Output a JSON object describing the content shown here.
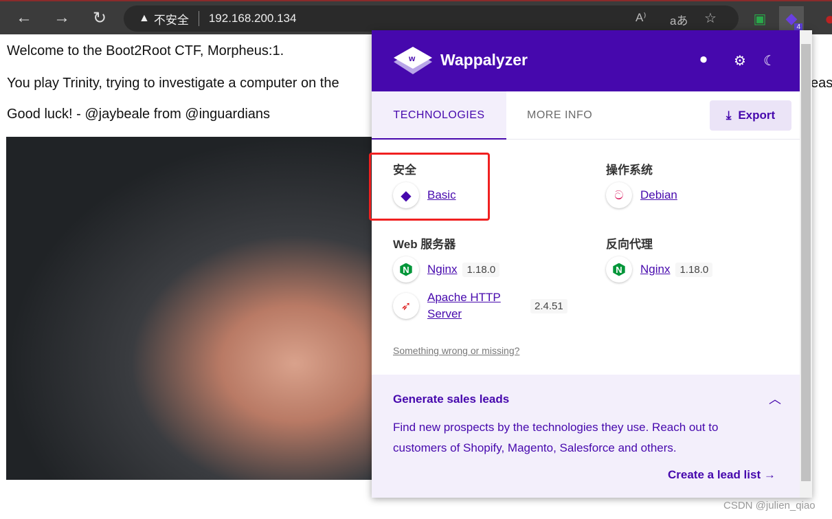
{
  "browser": {
    "security_label": "不安全",
    "url": "192.168.200.134",
    "extension_badge": "4"
  },
  "page": {
    "line1": "Welcome to the Boot2Root CTF, Morpheus:1.",
    "line2": "You play Trinity, trying to investigate a computer on the",
    "line2_tail": "east",
    "line3": "Good luck! - @jaybeale from @inguardians"
  },
  "wappalyzer": {
    "brand": "Wappalyzer",
    "accent": "#4608ad",
    "tabs": {
      "technologies": "TECHNOLOGIES",
      "more_info": "MORE INFO"
    },
    "export": "Export",
    "categories": [
      {
        "name": "安全",
        "techs": [
          {
            "name": "Basic",
            "icon": "wappalyzer-diamond-icon"
          }
        ]
      },
      {
        "name": "操作系统",
        "techs": [
          {
            "name": "Debian",
            "icon": "debian-swirl-icon"
          }
        ]
      },
      {
        "name": "Web 服务器",
        "techs": [
          {
            "name": "Nginx",
            "version": "1.18.0",
            "icon": "nginx-icon"
          },
          {
            "name": "Apache HTTP Server",
            "version": "2.4.51",
            "icon": "apache-feather-icon"
          }
        ]
      },
      {
        "name": "反向代理",
        "techs": [
          {
            "name": "Nginx",
            "version": "1.18.0",
            "icon": "nginx-icon"
          }
        ]
      }
    ],
    "feedback": "Something wrong or missing?",
    "leads": {
      "title": "Generate sales leads",
      "description": "Find new prospects by the technologies they use. Reach out to customers of Shopify, Magento, Salesforce and others.",
      "cta": "Create a lead list"
    }
  },
  "watermark": "CSDN @julien_qiao"
}
